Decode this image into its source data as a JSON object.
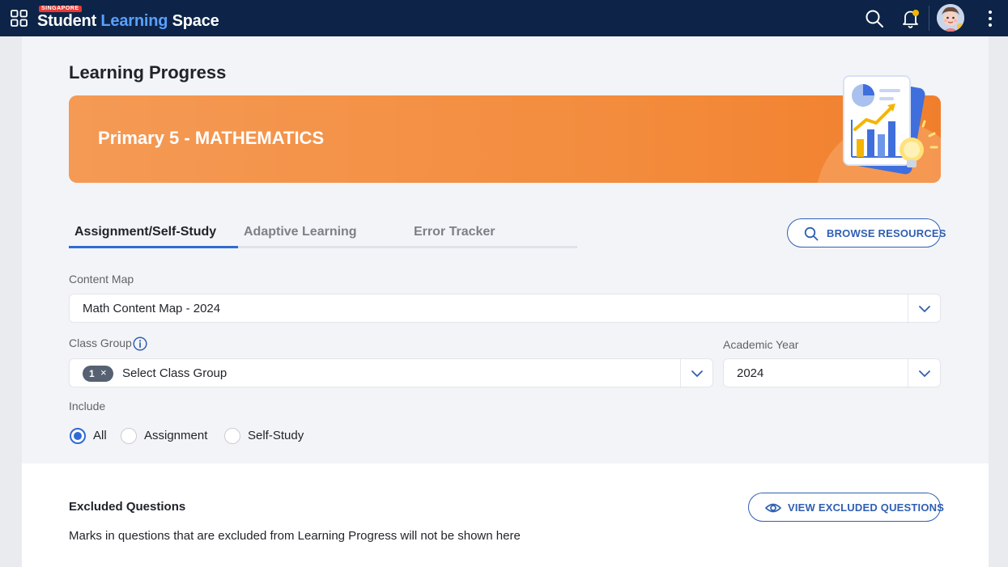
{
  "topbar": {
    "logo_badge": "SINGAPORE",
    "logo_word1": "Student",
    "logo_word2": "Learning",
    "logo_word3": "Space"
  },
  "page": {
    "title": "Learning Progress"
  },
  "banner": {
    "title": "Primary 5 - MATHEMATICS"
  },
  "tabs": [
    {
      "label": "Assignment/Self-Study",
      "active": true
    },
    {
      "label": "Adaptive Learning",
      "active": false
    },
    {
      "label": "Error Tracker",
      "active": false
    }
  ],
  "browse_button": {
    "label": "BROWSE RESOURCES"
  },
  "content_map": {
    "label": "Content Map",
    "value": "Math Content Map - 2024"
  },
  "class_group": {
    "label": "Class Group",
    "chip_count": "1",
    "chip_remove": "×",
    "placeholder": "Select Class Group"
  },
  "academic_year": {
    "label": "Academic Year",
    "value": "2024"
  },
  "include": {
    "label": "Include",
    "options": [
      {
        "label": "All",
        "checked": true
      },
      {
        "label": "Assignment",
        "checked": false
      },
      {
        "label": "Self-Study",
        "checked": false
      }
    ]
  },
  "excluded": {
    "title": "Excluded Questions",
    "description": "Marks in questions that are excluded from Learning Progress will not be shown here",
    "button_label": "VIEW EXCLUDED QUESTIONS"
  },
  "icons": {
    "apps": "apps-grid-icon",
    "search": "search-icon",
    "bell": "bell-icon",
    "more": "more-vertical-icon",
    "info": "info-icon",
    "chevron": "chevron-down-icon",
    "eye": "eye-icon"
  },
  "colors": {
    "topbar": "#0d2448",
    "accent": "#2f6bd6",
    "banner": "#f38a3a",
    "notification_dot": "#f5b400"
  }
}
